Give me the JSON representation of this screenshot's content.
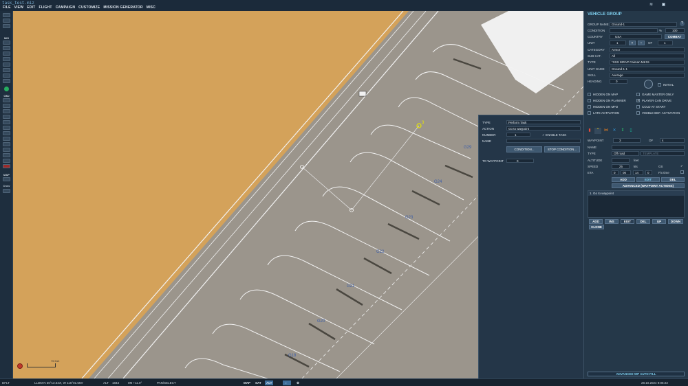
{
  "window": {
    "title": "task_test.miz"
  },
  "menu": [
    "FILE",
    "VIEW",
    "EDIT",
    "FLIGHT",
    "CAMPAIGN",
    "CUSTOMIZE",
    "MISSION GENERATOR",
    "MISC"
  ],
  "left_toolbar": {
    "section_mis": "MIS",
    "section_obj": "OBJ",
    "section_map": "MAP",
    "draw_label": "Draw"
  },
  "map": {
    "scale_label": "75 feet",
    "parking_labels": [
      "G29",
      "G24",
      "G23",
      "G22",
      "G21",
      "G20",
      "G18"
    ],
    "waypoint_label": "3"
  },
  "task_panel": {
    "type_label": "TYPE",
    "type_value": "Perform Task",
    "action_label": "ACTION",
    "action_value": "Go to waypoint",
    "number_label": "NUMBER",
    "number_value": "1",
    "enable_task_label": "ENABLE TASK",
    "name_label": "NAME",
    "name_value": "",
    "condition_button": "CONDITION...",
    "stop_condition_button": "STOP CONDITION...",
    "to_waypoint_label": "TO WAYPOINT",
    "to_waypoint_value": "0"
  },
  "vehicle_group": {
    "title": "VEHICLE GROUP",
    "help_icon": "?",
    "group_name_label": "GROUP NAME",
    "group_name_value": "Ground-1",
    "condition_label": "CONDITION",
    "condition_pct": "%",
    "condition_value": "100",
    "country_label": "COUNTRY",
    "country_value": "USA",
    "combat_button": "COMBAT",
    "unit_label": "UNIT",
    "unit_value": "1",
    "unit_of_label": "OF",
    "unit_of_value": "1",
    "category_label": "CATEGORY",
    "category_value": "Armor",
    "subcat_label": "SUB CAT.",
    "subcat_value": "All",
    "type_label": "TYPE",
    "type_value": "*SSS MRAP Caiman MK19",
    "unit_name_label": "UNIT NAME",
    "unit_name_value": "Ground-1-1",
    "skill_label": "SKILL",
    "skill_value": "Average",
    "heading_label": "HEADING",
    "heading_value": "0",
    "initial_label": "INITIAL",
    "checks_left": [
      {
        "label": "HIDDEN ON MAP",
        "checked": false
      },
      {
        "label": "HIDDEN ON PLANNER",
        "checked": false
      },
      {
        "label": "HIDDEN ON MFD",
        "checked": false
      },
      {
        "label": "LATE ACTIVATION",
        "checked": false
      }
    ],
    "checks_right": [
      {
        "label": "GAME MASTER ONLY",
        "checked": false
      },
      {
        "label": "PLAYER CAN DRIVE",
        "checked": true
      },
      {
        "label": "COLD AT START",
        "checked": false
      },
      {
        "label": "VISIBLE BEF. ACTIVATION",
        "checked": false
      }
    ],
    "waypoint_label": "WAYPOINT",
    "waypoint_value": "3",
    "waypoint_of_label": "OF",
    "waypoint_of_value": "4",
    "wp_name_label": "NAME",
    "wp_name_value": "",
    "wp_type_label": "TYPE",
    "wp_type_value": "Off road",
    "template_label": "TEMPLATE",
    "altitude_label": "ALTITUDE",
    "altitude_unit": "feet",
    "speed_label": "SPEED",
    "speed_value": "25",
    "speed_unit": "kts",
    "gs_label": "GS",
    "eta_label": "ETA",
    "eta_values": [
      "0",
      "00",
      "14",
      "0"
    ],
    "fix_time_label": "Fix time",
    "add_button": "ADD",
    "edit_button": "EDIT",
    "del_button": "DEL",
    "advanced_button": "ADVANCED (WAYPOINT ACTIONS)",
    "action_list": [
      "1. Go to waypoint"
    ],
    "list_buttons": [
      "ADD",
      "INS",
      "EDIT",
      "DEL",
      "UP",
      "DOWN"
    ],
    "clone_button": "CLONE",
    "auto_fill_button": "ADVANCED WP AUTO FILL"
  },
  "status_bar": {
    "mode": "DFLT",
    "coords": "LLDM  N 36°13.643', W 115°01.594'",
    "alt_label": "ALT",
    "alt_value": "1843",
    "zoom": "0M  +11.0°",
    "tool": "PAN/SELECT",
    "map_modes": [
      "MAP",
      "SAT",
      "ALT"
    ],
    "datetime": "28.10.2024 9:06:23"
  },
  "colors": {
    "accent": "#7fd0f0",
    "sand": "#d4a25a",
    "tarmac": "#9b958c",
    "panel": "#253849"
  }
}
